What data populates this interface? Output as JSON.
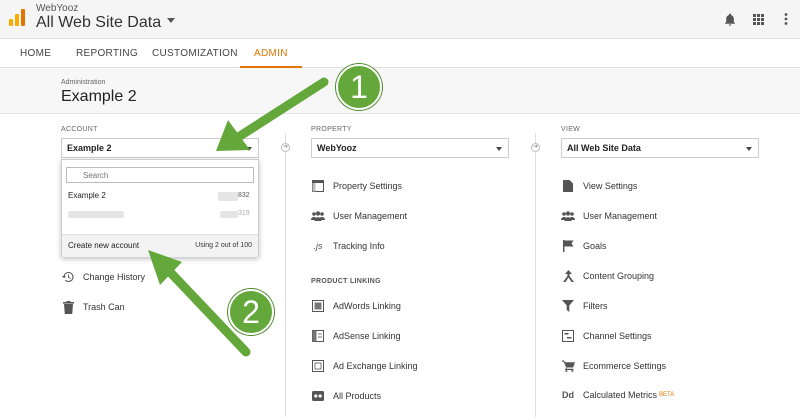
{
  "topbar": {
    "account_name": "WebYooz",
    "property_view": "All Web Site Data",
    "icons": [
      "bell-icon",
      "apps-grid-icon",
      "more-vert-icon"
    ]
  },
  "nav": {
    "tabs": [
      "HOME",
      "REPORTING",
      "CUSTOMIZATION",
      "ADMIN"
    ],
    "active": "ADMIN"
  },
  "header": {
    "breadcrumb": "Administration",
    "title": "Example 2"
  },
  "account": {
    "label": "ACCOUNT",
    "selected": "Example 2",
    "dropdown": {
      "search_placeholder": "Search",
      "rows": [
        {
          "name": "Example 2",
          "id_suffix": "832"
        },
        {
          "name": "",
          "id_suffix": "319"
        }
      ],
      "create_label": "Create new account",
      "usage": "Using 2 out of 100"
    },
    "items": [
      {
        "label": "Change History",
        "icon": "history-icon"
      },
      {
        "label": "Trash Can",
        "icon": "trash-icon"
      }
    ]
  },
  "property": {
    "label": "PROPERTY",
    "selected": "WebYooz",
    "items": [
      {
        "label": "Property Settings",
        "icon": "settings-window-icon"
      },
      {
        "label": "User Management",
        "icon": "users-icon"
      },
      {
        "label": "Tracking Info",
        "icon": "js-icon"
      }
    ],
    "section": "PRODUCT LINKING",
    "linking": [
      {
        "label": "AdWords Linking",
        "icon": "adwords-icon"
      },
      {
        "label": "AdSense Linking",
        "icon": "adsense-icon"
      },
      {
        "label": "Ad Exchange Linking",
        "icon": "ad-exchange-icon"
      },
      {
        "label": "All Products",
        "icon": "all-products-icon"
      }
    ]
  },
  "view": {
    "label": "VIEW",
    "selected": "All Web Site Data",
    "items": [
      {
        "label": "View Settings",
        "icon": "document-icon"
      },
      {
        "label": "User Management",
        "icon": "users-icon"
      },
      {
        "label": "Goals",
        "icon": "flag-icon"
      },
      {
        "label": "Content Grouping",
        "icon": "content-grouping-icon"
      },
      {
        "label": "Filters",
        "icon": "filter-icon"
      },
      {
        "label": "Channel Settings",
        "icon": "channel-settings-icon"
      },
      {
        "label": "Ecommerce Settings",
        "icon": "cart-icon"
      },
      {
        "label": "Calculated Metrics",
        "icon": "dd-icon",
        "badge": "BETA"
      }
    ]
  },
  "annotations": {
    "badge1": "1",
    "badge2": "2",
    "color": "#64a73b"
  },
  "colors": {
    "accent": "#e37400",
    "annotation": "#64a73b"
  }
}
